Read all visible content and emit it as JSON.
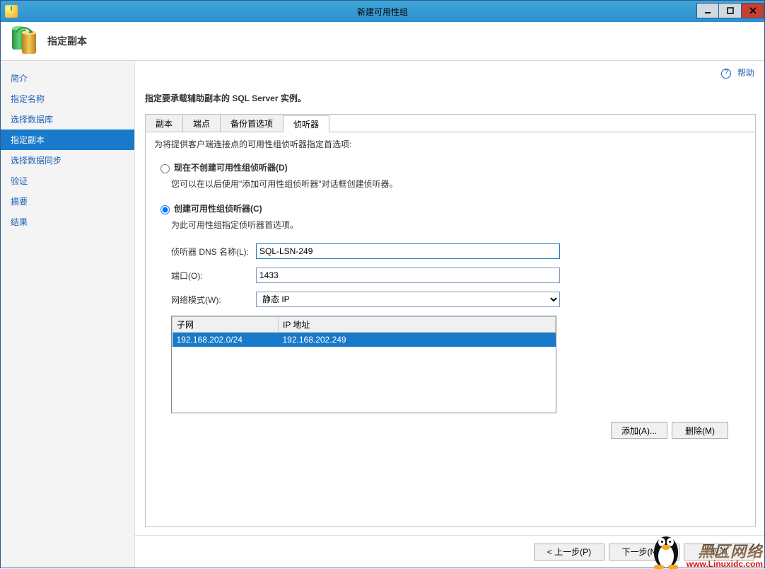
{
  "window": {
    "title": "新建可用性组"
  },
  "header": {
    "title": "指定副本"
  },
  "help": {
    "label": "帮助"
  },
  "sidebar": {
    "items": [
      {
        "label": "简介"
      },
      {
        "label": "指定名称"
      },
      {
        "label": "选择数据库"
      },
      {
        "label": "指定副本"
      },
      {
        "label": "选择数据同步"
      },
      {
        "label": "验证"
      },
      {
        "label": "摘要"
      },
      {
        "label": "结果"
      }
    ],
    "active_index": 3
  },
  "main": {
    "instruction": "指定要承载辅助副本的 SQL Server 实例。",
    "tabs": [
      {
        "label": "副本"
      },
      {
        "label": "端点"
      },
      {
        "label": "备份首选项"
      },
      {
        "label": "侦听器"
      }
    ],
    "active_tab": 3,
    "listener": {
      "desc": "为将提供客户端连接点的可用性组侦听器指定首选项:",
      "radio_none": {
        "label": "现在不创建可用性组侦听器(D)",
        "sub": "您可以在以后使用\"添加可用性组侦听器\"对话框创建侦听器。"
      },
      "radio_create": {
        "label": "创建可用性组侦听器(C)",
        "sub": "为此可用性组指定侦听器首选项。"
      },
      "selected": "create",
      "dns_label": "侦听器 DNS 名称(L):",
      "dns_value": "SQL-LSN-249",
      "port_label": "端口(O):",
      "port_value": "1433",
      "netmode_label": "网络模式(W):",
      "netmode_value": "静态 IP",
      "grid": {
        "col_subnet": "子网",
        "col_ip": "IP 地址",
        "rows": [
          {
            "subnet": "192.168.202.0/24",
            "ip": "192.168.202.249"
          }
        ]
      },
      "btn_add": "添加(A)...",
      "btn_remove": "删除(M)"
    }
  },
  "footer": {
    "prev": "< 上一步(P)",
    "next": "下一步(N) >",
    "cancel": "取消"
  },
  "watermark": {
    "line1": "黑区网络",
    "line2": "www.Linuxidc.com"
  }
}
